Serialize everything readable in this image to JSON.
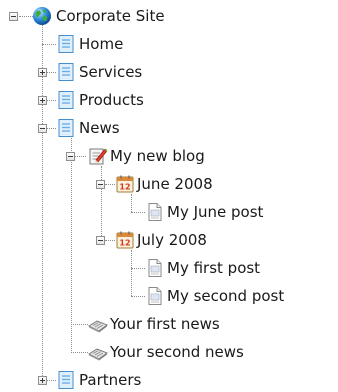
{
  "tree": {
    "root": {
      "label": "Corporate Site",
      "icon": "globe-icon",
      "expanded": true
    },
    "items": {
      "home": {
        "label": "Home",
        "icon": "page-icon"
      },
      "services": {
        "label": "Services",
        "icon": "page-icon",
        "expanded": false
      },
      "products": {
        "label": "Products",
        "icon": "page-icon",
        "expanded": false
      },
      "news": {
        "label": "News",
        "icon": "page-icon",
        "expanded": true
      },
      "blog": {
        "label": "My new blog",
        "icon": "blog-icon",
        "expanded": true
      },
      "june": {
        "label": "June 2008",
        "icon": "calendar-icon",
        "expanded": true,
        "calendar_day": "12"
      },
      "june_post": {
        "label": "My June post",
        "icon": "post-icon"
      },
      "july": {
        "label": "July 2008",
        "icon": "calendar-icon",
        "expanded": true,
        "calendar_day": "12"
      },
      "first_post": {
        "label": "My first post",
        "icon": "post-icon"
      },
      "second_post": {
        "label": "My second post",
        "icon": "post-icon"
      },
      "first_news": {
        "label": "Your first news",
        "icon": "newspaper-icon"
      },
      "second_news": {
        "label": "Your second news",
        "icon": "newspaper-icon"
      },
      "partners": {
        "label": "Partners",
        "icon": "page-icon",
        "expanded": false
      }
    }
  }
}
